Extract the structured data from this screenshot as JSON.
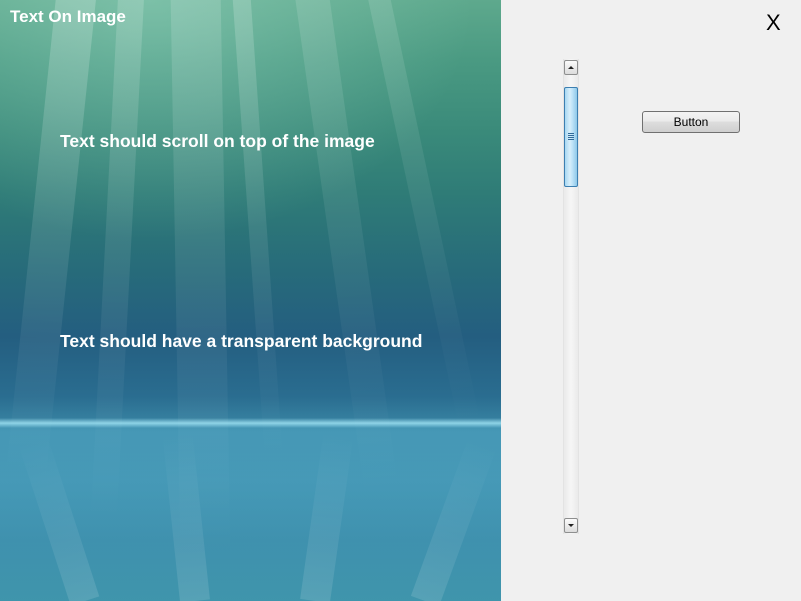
{
  "window": {
    "close_label": "X"
  },
  "image_panel": {
    "title": "Text On Image",
    "lines": [
      "Text should scroll on top of the image",
      "Text should have a transparent background"
    ]
  },
  "controls": {
    "button_label": "Button"
  },
  "scrollbar": {
    "position_fraction": 0.0
  },
  "colors": {
    "thumb_accent": "#a8d8f2",
    "form_background": "#f0f0f0",
    "image_top": "#5ea98d",
    "image_bottom": "#3e93aa"
  }
}
